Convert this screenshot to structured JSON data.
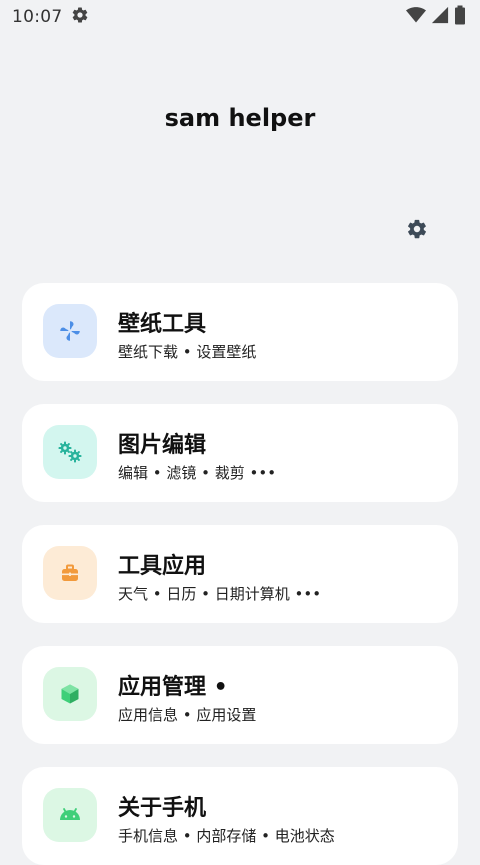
{
  "status_bar": {
    "time": "10:07",
    "icons": [
      "settings-gear-icon",
      "wifi-icon",
      "signal-icon",
      "battery-icon"
    ]
  },
  "header": {
    "title": "sam helper",
    "settings_icon": "gear-icon"
  },
  "cards": [
    {
      "title": "壁纸工具",
      "subtitle": "壁纸下载 • 设置壁纸",
      "icon": "pinwheel-icon",
      "icon_bg": "#dbe8fb",
      "icon_color": "#4c8ee6"
    },
    {
      "title": "图片编辑",
      "subtitle": "编辑 • 滤镜 • 裁剪 •••",
      "icon": "gears-icon",
      "icon_bg": "#d3f6ef",
      "icon_color": "#27b39c"
    },
    {
      "title": "工具应用",
      "subtitle": "天气 • 日历 • 日期计算机 •••",
      "icon": "toolbox-icon",
      "icon_bg": "#fdebd6",
      "icon_color": "#f29a3c"
    },
    {
      "title": "应用管理 •",
      "subtitle": "应用信息 • 应用设置",
      "icon": "cube-icon",
      "icon_bg": "#dcf7e4",
      "icon_color": "#3fcf79"
    },
    {
      "title": "关于手机",
      "subtitle": "手机信息 • 内部存储 • 电池状态",
      "icon": "android-icon",
      "icon_bg": "#dcf7e4",
      "icon_color": "#3fcf79"
    }
  ]
}
